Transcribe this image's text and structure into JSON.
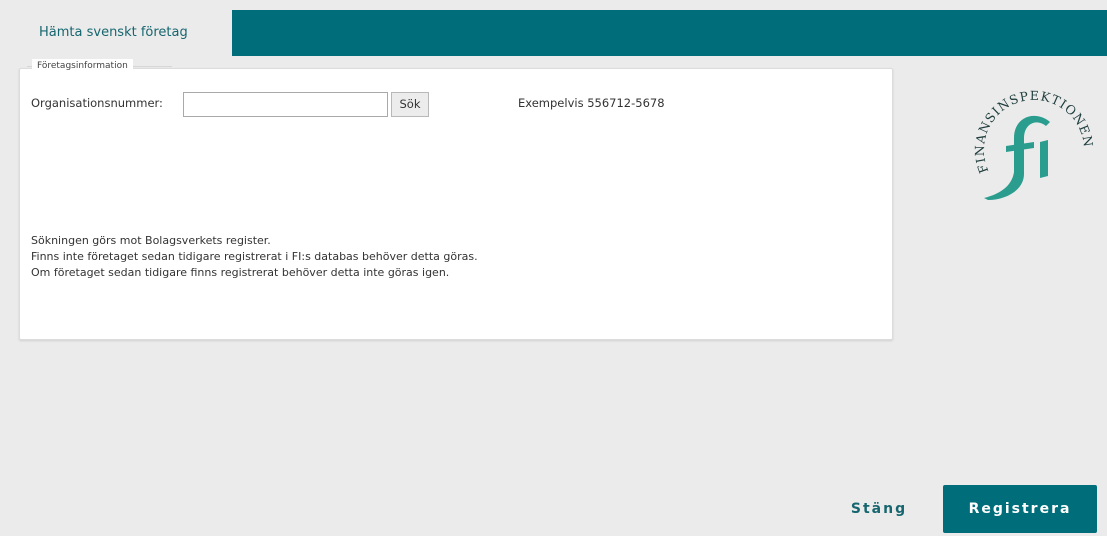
{
  "tabs": [
    {
      "label": "Hämta svenskt företag",
      "active": true
    }
  ],
  "company_info": {
    "legend": "Företagsinformation",
    "org_number_label": "Organisationsnummer:",
    "org_number_value": "",
    "search_button": "Sök",
    "example_text": "Exempelvis 556712-5678",
    "info_lines": [
      "Sökningen görs mot Bolagsverkets register.",
      "Finns inte företaget sedan tidigare registrerat i FI:s databas behöver detta göras.",
      "Om företaget sedan tidigare finns registrerat behöver detta inte göras igen."
    ]
  },
  "logo": {
    "name": "finansinspektionen-logo",
    "text": "FINANSINSPEKTIONEN",
    "color": "#2a9d8f"
  },
  "footer": {
    "close_label": "Stäng",
    "register_label": "Registrera"
  },
  "colors": {
    "accent": "#006e7a",
    "background": "#ebebeb"
  }
}
